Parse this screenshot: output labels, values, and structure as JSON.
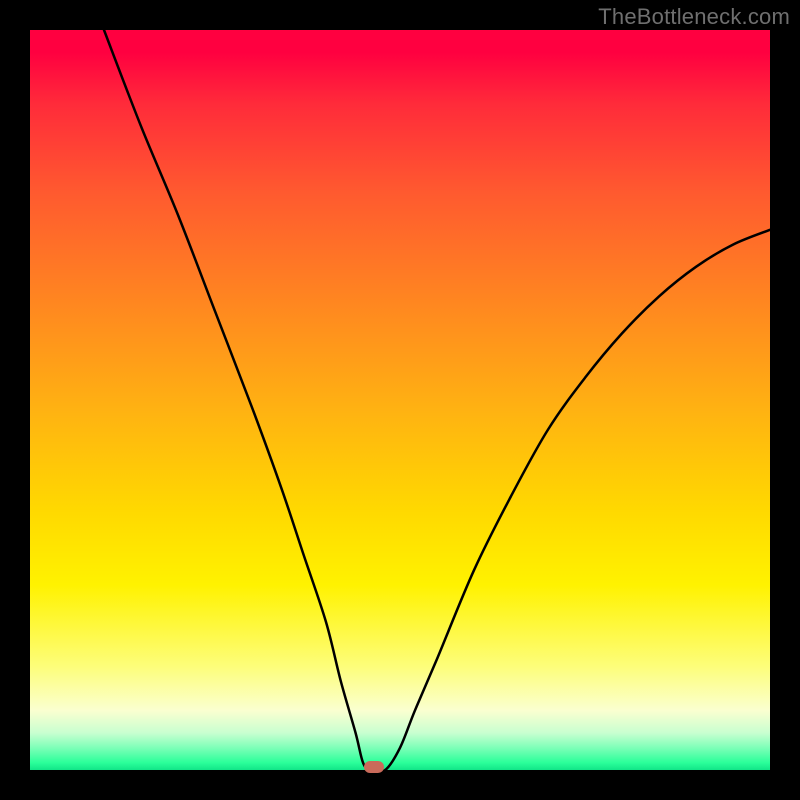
{
  "watermark": "TheBottleneck.com",
  "chart_data": {
    "type": "line",
    "title": "",
    "xlabel": "",
    "ylabel": "",
    "xlim": [
      0,
      100
    ],
    "ylim": [
      0,
      100
    ],
    "grid": false,
    "legend": false,
    "background_gradient": {
      "direction": "vertical",
      "stops": [
        {
          "pos": 0.0,
          "color": "#ff0040"
        },
        {
          "pos": 0.65,
          "color": "#ffd900"
        },
        {
          "pos": 0.92,
          "color": "#faffd0"
        },
        {
          "pos": 1.0,
          "color": "#11E588"
        }
      ]
    },
    "series": [
      {
        "name": "bottleneck-curve",
        "color": "#000000",
        "x": [
          10,
          15,
          20,
          25,
          30,
          34,
          37,
          40,
          42,
          44,
          45,
          46,
          48,
          50,
          52,
          55,
          60,
          65,
          70,
          75,
          80,
          85,
          90,
          95,
          100
        ],
        "values": [
          100,
          87,
          75,
          62,
          49,
          38,
          29,
          20,
          12,
          5,
          1,
          0,
          0,
          3,
          8,
          15,
          27,
          37,
          46,
          53,
          59,
          64,
          68,
          71,
          73
        ]
      }
    ],
    "marker": {
      "name": "optimum-point",
      "x": 46.5,
      "y": 0,
      "color": "#c96a5a"
    }
  }
}
